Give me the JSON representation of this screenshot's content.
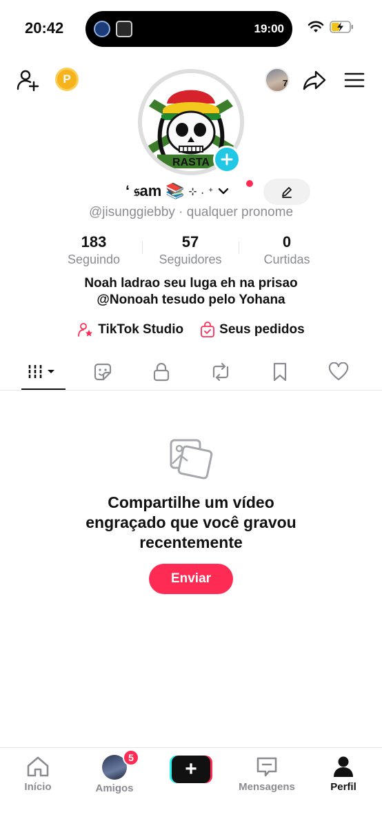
{
  "status_bar": {
    "time": "20:42",
    "island_time": "19:00",
    "icons": [
      "club-crest-icon",
      "team-badge-icon",
      "wifi-icon",
      "battery-charging-icon"
    ]
  },
  "header": {
    "coin_label": "P",
    "mini_avatar_badge": "7",
    "icons": [
      "add-friend-icon",
      "share-icon",
      "menu-icon"
    ]
  },
  "profile": {
    "name": "ʻ 𝔰am 📚",
    "name_deco": "⊹ ˖ ⁺",
    "handle": "@jisunggiebby · qualquer pronome",
    "stats": [
      {
        "value": "183",
        "label": "Seguindo"
      },
      {
        "value": "57",
        "label": "Seguidores"
      },
      {
        "value": "0",
        "label": "Curtidas"
      }
    ],
    "bio_line1": "Noah ladrao seu luga eh na prisao",
    "bio_line2": "@Nonoah tesudo pelo Yohana",
    "links": {
      "studio": "TikTok Studio",
      "orders": "Seus pedidos"
    }
  },
  "tabs": [
    "videos-grid-icon",
    "reposts-sticker-icon",
    "lock-icon",
    "repost-icon",
    "bookmark-icon",
    "heart-icon"
  ],
  "empty_state": {
    "text_line1": "Compartilhe um vídeo",
    "text_line2": "engraçado que você gravou",
    "text_line3": "recentemente",
    "button": "Enviar"
  },
  "bottom_nav": {
    "home": "Início",
    "friends": "Amigos",
    "friends_badge": "5",
    "create": "+",
    "messages": "Mensagens",
    "profile": "Perfil"
  },
  "colors": {
    "accent": "#fe2c55",
    "cyan": "#25f4ee",
    "muted": "#8a8b91",
    "add_button": "#20c8e6",
    "coin": "#f6b31b"
  }
}
